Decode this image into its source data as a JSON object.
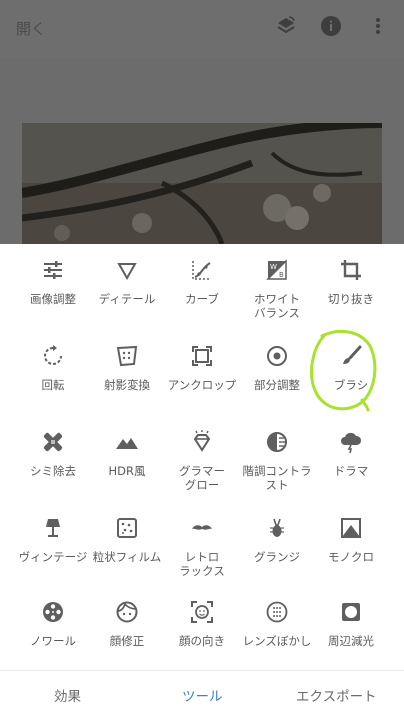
{
  "topbar": {
    "open_label": "開く",
    "icons": [
      "layers-icon",
      "info-icon",
      "more-vert-icon"
    ]
  },
  "photo": {
    "description_icon": "cherry-blossom-photo"
  },
  "tools": [
    {
      "label": "画像調整",
      "icon": "tune-icon"
    },
    {
      "label": "ディテール",
      "icon": "triangle-down-icon"
    },
    {
      "label": "カーブ",
      "icon": "curve-icon"
    },
    {
      "label": "ホワイト\nバランス",
      "icon": "white-balance-icon"
    },
    {
      "label": "切り抜き",
      "icon": "crop-icon"
    },
    {
      "label": "回転",
      "icon": "rotate-icon"
    },
    {
      "label": "射影変換",
      "icon": "perspective-icon"
    },
    {
      "label": "アンクロップ",
      "icon": "expand-icon"
    },
    {
      "label": "部分調整",
      "icon": "target-icon"
    },
    {
      "label": "ブラシ",
      "icon": "brush-icon"
    },
    {
      "label": "シミ除去",
      "icon": "healing-icon"
    },
    {
      "label": "HDR風",
      "icon": "mountain-icon"
    },
    {
      "label": "グラマー\nグロー",
      "icon": "diamond-icon"
    },
    {
      "label": "階調コントラ\nスト",
      "icon": "tonal-contrast-icon"
    },
    {
      "label": "ドラマ",
      "icon": "storm-cloud-icon"
    },
    {
      "label": "ヴィンテージ",
      "icon": "lamp-icon"
    },
    {
      "label": "粒状フィルム",
      "icon": "grain-icon"
    },
    {
      "label": "レトロ\nラックス",
      "icon": "mustache-icon"
    },
    {
      "label": "グランジ",
      "icon": "guitar-icon"
    },
    {
      "label": "モノクロ",
      "icon": "mountain-frame-icon"
    },
    {
      "label": "ノワール",
      "icon": "film-reel-icon"
    },
    {
      "label": "顔修正",
      "icon": "face-icon"
    },
    {
      "label": "顔の向き",
      "icon": "face-frame-icon"
    },
    {
      "label": "レンズぼかし",
      "icon": "lens-blur-icon"
    },
    {
      "label": "周辺減光",
      "icon": "vignette-icon"
    }
  ],
  "tabs": {
    "effects": "効果",
    "tools": "ツール",
    "export": "エクスポート",
    "active": "tools"
  },
  "colors": {
    "accent": "#3b7fd6",
    "highlight_circle": "#a6e22e",
    "icon": "#5f5f5f"
  }
}
